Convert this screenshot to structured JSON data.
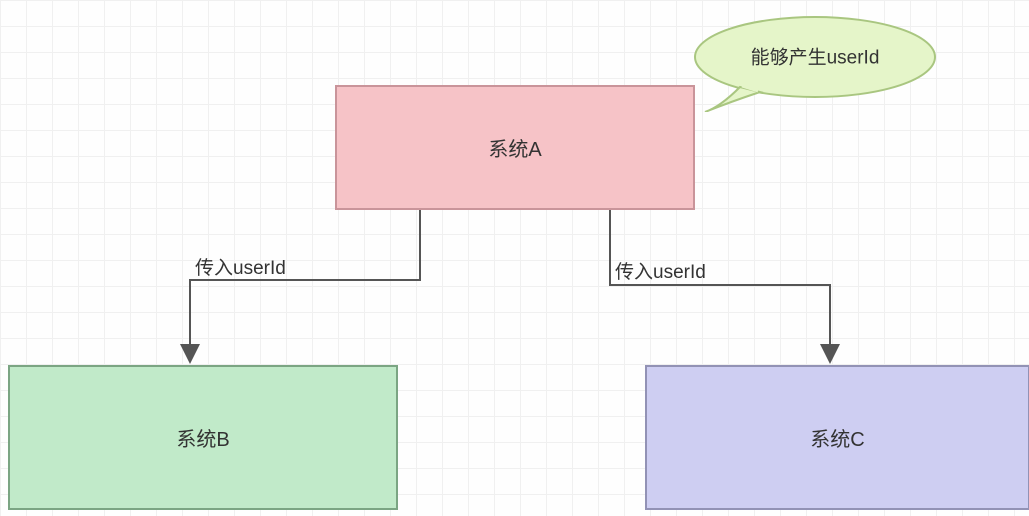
{
  "nodes": {
    "a": {
      "label": "系统A"
    },
    "b": {
      "label": "系统B"
    },
    "c": {
      "label": "系统C"
    }
  },
  "callout": {
    "text": "能够产生userId"
  },
  "edges": {
    "a_to_b": {
      "label": "传入userId"
    },
    "a_to_c": {
      "label": "传入userId"
    }
  },
  "colors": {
    "node_a_fill": "#f6c3c7",
    "node_a_stroke": "#c9949a",
    "node_b_fill": "#c1eac9",
    "node_b_stroke": "#7ba583",
    "node_c_fill": "#cecef2",
    "node_c_stroke": "#9292b5",
    "callout_fill": "#e5f5c9",
    "callout_stroke": "#a9c680"
  }
}
